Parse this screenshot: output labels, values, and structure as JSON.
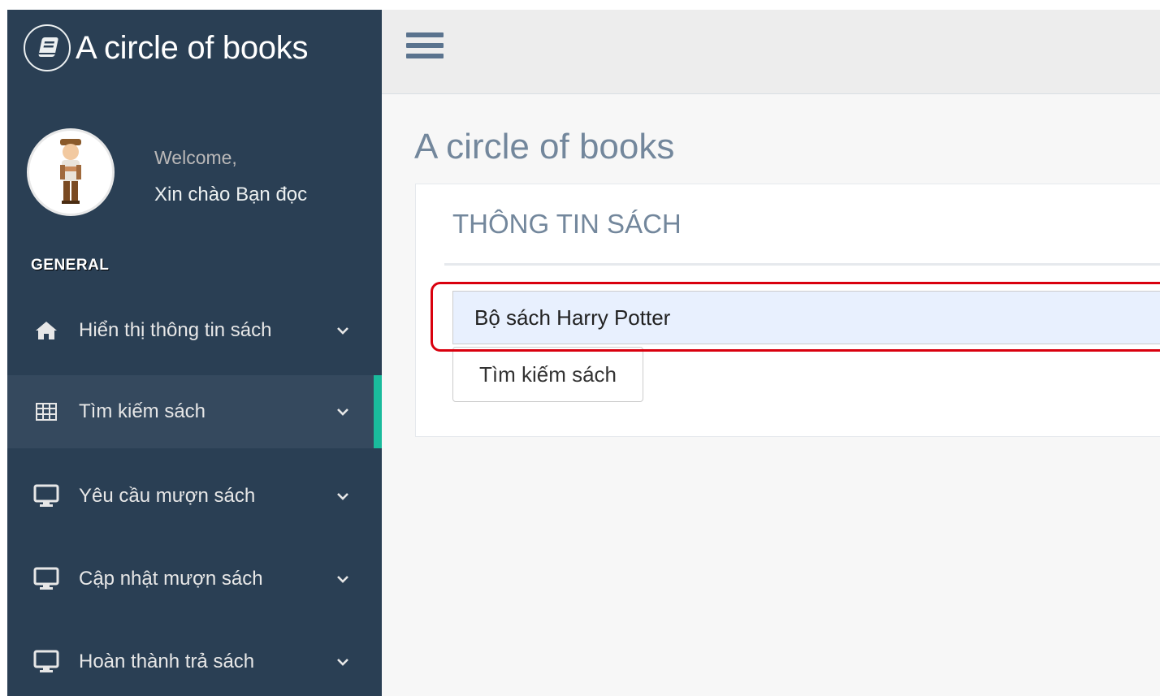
{
  "app": {
    "title": "A circle of books"
  },
  "profile": {
    "welcome": "Welcome,",
    "name": "Xin chào Bạn đọc"
  },
  "sidebar": {
    "section_title": "GENERAL",
    "items": [
      {
        "label": "Hiển thị thông tin sách",
        "icon": "home-icon",
        "active": false
      },
      {
        "label": "Tìm kiếm sách",
        "icon": "table-icon",
        "active": true
      },
      {
        "label": "Yêu cầu mượn sách",
        "icon": "desktop-icon",
        "active": false
      },
      {
        "label": "Cập nhật mượn sách",
        "icon": "desktop-icon",
        "active": false
      },
      {
        "label": "Hoàn thành trả sách",
        "icon": "desktop-icon",
        "active": false
      }
    ]
  },
  "main": {
    "page_title": "A circle of books",
    "panel": {
      "title": "THÔNG TIN SÁCH",
      "search_value": "Bộ sách Harry Potter",
      "search_button": "Tìm kiếm sách"
    }
  },
  "colors": {
    "sidebar_bg": "#2a3f54",
    "active_item_bg": "#35495e",
    "active_accent": "#1abb9c",
    "highlight": "#d9000e",
    "input_bg": "#e8f0fe"
  }
}
